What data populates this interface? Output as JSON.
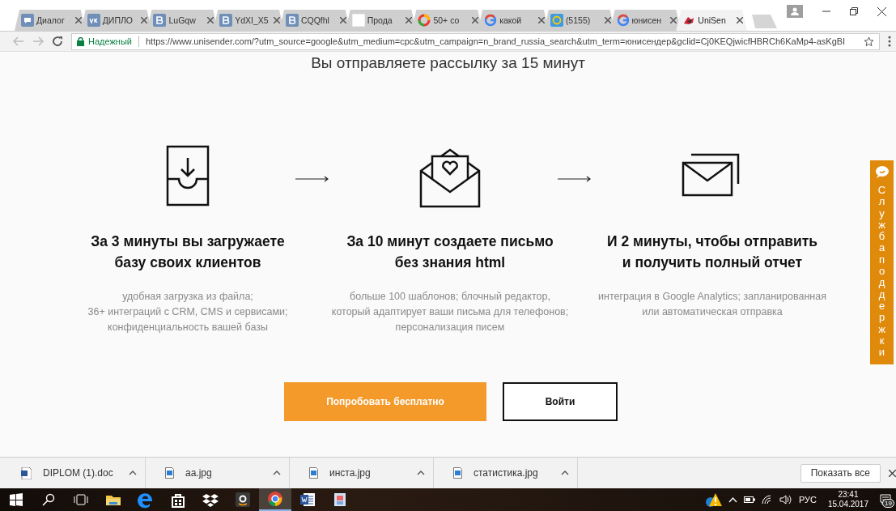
{
  "browser": {
    "tabs": [
      {
        "title": "Диалог",
        "selected": false
      },
      {
        "title": "ДИПЛО",
        "selected": false
      },
      {
        "title": "LuGqw",
        "selected": false
      },
      {
        "title": "YdXI_X5",
        "selected": false
      },
      {
        "title": "CQQfhl",
        "selected": false
      },
      {
        "title": "Прода",
        "selected": false
      },
      {
        "title": "50+ со",
        "selected": false
      },
      {
        "title": "какой",
        "selected": false
      },
      {
        "title": "(5155)",
        "selected": false
      },
      {
        "title": "юнисен",
        "selected": false
      },
      {
        "title": "UniSen",
        "selected": true
      }
    ],
    "secure_label": "Надежный",
    "url": "https://www.unisender.com/?utm_source=google&utm_medium=cpc&utm_campaign=n_brand_russia_search&utm_term=юнисендер&gclid=Cj0KEQjwicfHBRCh6KaMp4-asKgBI"
  },
  "page": {
    "heading": "Вы отправляете рассылку за 15 минут",
    "steps": [
      {
        "title": [
          "За 3 минуты вы загружаете",
          "базу своих клиентов"
        ],
        "description": [
          "удобная загрузка из файла;",
          "36+ интеграций с CRM, CMS и сервисами;",
          "конфиденциальность вашей базы"
        ]
      },
      {
        "title": [
          "За 10 минут создаете письмо",
          "без знания html"
        ],
        "description": [
          "больше 100 шаблонов; блочный редактор,",
          "который адаптирует ваши письма для телефонов;",
          "персонализация писем"
        ]
      },
      {
        "title": [
          "И 2 минуты, чтобы отправить",
          "и получить полный отчет"
        ],
        "description": [
          "интеграция в Google Analytics; запланированная",
          "или автоматическая отправка"
        ]
      }
    ],
    "buttons": [
      {
        "label": "Попробовать бесплатно",
        "kind": "primary"
      },
      {
        "label": "Войти",
        "kind": "outline"
      }
    ],
    "support_tab": "Служба поддержки"
  },
  "downloads": {
    "items": [
      {
        "file": "DIPLOM (1).doc",
        "kind": "doc"
      },
      {
        "file": "aa.jpg",
        "kind": "image"
      },
      {
        "file": "инста.jpg",
        "kind": "image"
      },
      {
        "file": "статистика.jpg",
        "kind": "image"
      }
    ],
    "show_all": "Показать все"
  },
  "taskbar": {
    "apps": [
      {
        "selected": false
      },
      {
        "selected": false
      },
      {
        "selected": false
      },
      {
        "selected": false
      },
      {
        "selected": false
      },
      {
        "selected": true
      },
      {
        "selected": false
      },
      {
        "selected": false
      }
    ],
    "language": "РУС",
    "time": "23:41",
    "date": "15.04.2017",
    "notifications": "19"
  }
}
